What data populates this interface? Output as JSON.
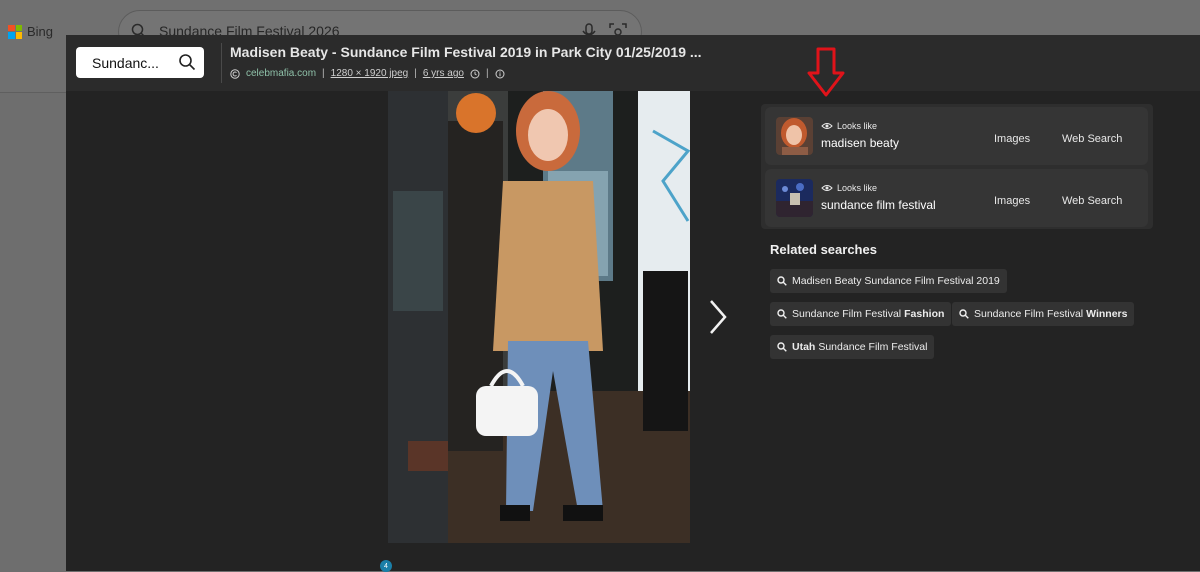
{
  "background": {
    "logo_text": "Bing",
    "search_query": "Sundance Film Festival 2026"
  },
  "viewer": {
    "search_value": "Sundanc...",
    "title": "Madisen Beaty - Sundance Film Festival 2019 in Park City 01/25/2019 ...",
    "meta": {
      "source": "celebmafia.com",
      "dimensions": "1280 × 1920 jpeg",
      "age": "6 yrs ago",
      "sep": "|"
    },
    "image_count_badge": "4"
  },
  "looks_like": [
    {
      "label": "Looks like",
      "name": "madisen beaty",
      "images_label": "Images",
      "web_label": "Web Search"
    },
    {
      "label": "Looks like",
      "name": "sundance film festival",
      "images_label": "Images",
      "web_label": "Web Search"
    }
  ],
  "related": {
    "title": "Related searches",
    "items": [
      {
        "prefix": "",
        "text": "Madisen Beaty Sundance Film Festival 2019",
        "bold": ""
      },
      {
        "prefix": "",
        "text": "Sundance Film Festival",
        "bold": "Fashion"
      },
      {
        "prefix": "",
        "text": "Sundance Film Festival",
        "bold": "Winners"
      },
      {
        "prefix": "Utah",
        "text": "Sundance Film Festival",
        "bold": ""
      }
    ]
  },
  "colors": {
    "annotation_arrow": "#e0131a",
    "overlay_bg": "#232323",
    "source_link": "#8fc1a9"
  }
}
